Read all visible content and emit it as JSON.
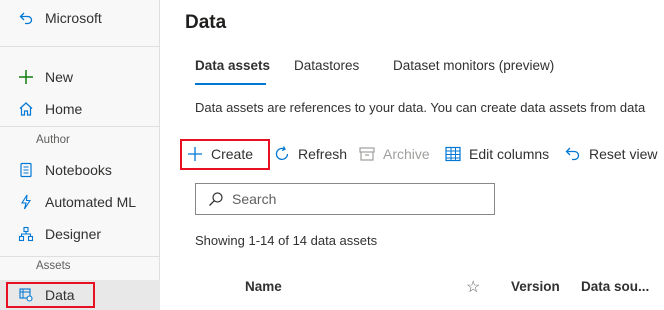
{
  "sidebar": {
    "back_label": "Microsoft",
    "new_label": "New",
    "home_label": "Home",
    "author_section": "Author",
    "notebooks_label": "Notebooks",
    "automl_label": "Automated ML",
    "designer_label": "Designer",
    "assets_section": "Assets",
    "data_label": "Data"
  },
  "main": {
    "title": "Data",
    "tabs": [
      {
        "label": "Data assets"
      },
      {
        "label": "Datastores"
      },
      {
        "label": "Dataset monitors (preview)"
      }
    ],
    "description": "Data assets are references to your data. You can create data assets from data",
    "toolbar": {
      "create": "Create",
      "refresh": "Refresh",
      "archive": "Archive",
      "edit_columns": "Edit columns",
      "reset_view": "Reset view"
    },
    "search": {
      "placeholder": "Search"
    },
    "showing": "Showing 1-14 of 14 data assets",
    "columns": {
      "name": "Name",
      "version": "Version",
      "data_source": "Data sou..."
    }
  },
  "colors": {
    "accent": "#0078d4",
    "highlight": "#e81123",
    "new_icon": "#107c10"
  }
}
